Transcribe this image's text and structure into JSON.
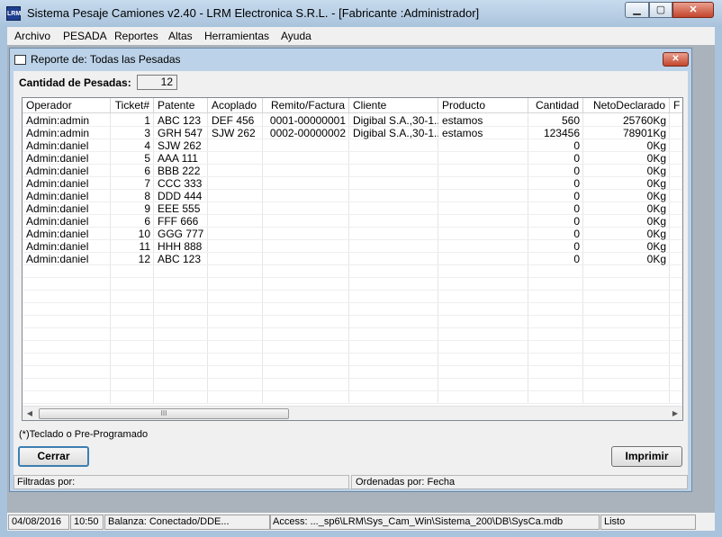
{
  "window": {
    "title": "Sistema Pesaje Camiones v2.40 - LRM Electronica S.R.L. - [Fabricante            :Administrador]",
    "icon_label": "LRM",
    "min_glyph": "▁",
    "max_glyph": "▢",
    "close_glyph": "✕"
  },
  "menu": [
    "Archivo",
    "PESADA",
    "Reportes",
    "Altas",
    "Herramientas",
    "Ayuda"
  ],
  "child": {
    "title": "Reporte de: Todas las Pesadas",
    "close_glyph": "✕",
    "count_label": "Cantidad de Pesadas:",
    "count_value": "12",
    "note": "(*)Teclado o Pre-Programado",
    "close_button": "Cerrar",
    "print_button": "Imprimir",
    "filter_label": "Filtradas por:",
    "order_label": "Ordenadas por: Fecha",
    "scroll_grip": "III",
    "scroll_left": "◀",
    "scroll_right": "▶"
  },
  "grid": {
    "columns": [
      "Operador",
      "Ticket#",
      "Patente",
      "Acoplado",
      "Remito/Factura",
      "Cliente",
      "Producto",
      "Cantidad",
      "NetoDeclarado",
      "F"
    ],
    "rows": [
      [
        "Admin:admin",
        "1",
        "ABC 123",
        "DEF 456",
        "0001-00000001",
        "Digibal S.A.,30-1...",
        "estamos",
        "560",
        "25760Kg"
      ],
      [
        "Admin:admin",
        "3",
        "GRH 547",
        "SJW 262",
        "0002-00000002",
        "Digibal S.A.,30-1...",
        "estamos",
        "123456",
        "78901Kg"
      ],
      [
        "Admin:daniel",
        "4",
        "SJW 262",
        "",
        "",
        "",
        "",
        "0",
        "0Kg"
      ],
      [
        "Admin:daniel",
        "5",
        "AAA 111",
        "",
        "",
        "",
        "",
        "0",
        "0Kg"
      ],
      [
        "Admin:daniel",
        "6",
        "BBB 222",
        "",
        "",
        "",
        "",
        "0",
        "0Kg"
      ],
      [
        "Admin:daniel",
        "7",
        "CCC 333",
        "",
        "",
        "",
        "",
        "0",
        "0Kg"
      ],
      [
        "Admin:daniel",
        "8",
        "DDD 444",
        "",
        "",
        "",
        "",
        "0",
        "0Kg"
      ],
      [
        "Admin:daniel",
        "9",
        "EEE 555",
        "",
        "",
        "",
        "",
        "0",
        "0Kg"
      ],
      [
        "Admin:daniel",
        "6",
        "FFF 666",
        "",
        "",
        "",
        "",
        "0",
        "0Kg"
      ],
      [
        "Admin:daniel",
        "10",
        "GGG 777",
        "",
        "",
        "",
        "",
        "0",
        "0Kg"
      ],
      [
        "Admin:daniel",
        "11",
        "HHH 888",
        "",
        "",
        "",
        "",
        "0",
        "0Kg"
      ],
      [
        "Admin:daniel",
        "12",
        "ABC 123",
        "",
        "",
        "",
        "",
        "0",
        "0Kg"
      ]
    ]
  },
  "status": {
    "date": "04/08/2016",
    "time": "10:50",
    "scale": "Balanza: Conectado/DDE...",
    "access": "Access: ..._sp6\\LRM\\Sys_Cam_Win\\Sistema_200\\DB\\SysCa.mdb",
    "state": "Listo"
  }
}
